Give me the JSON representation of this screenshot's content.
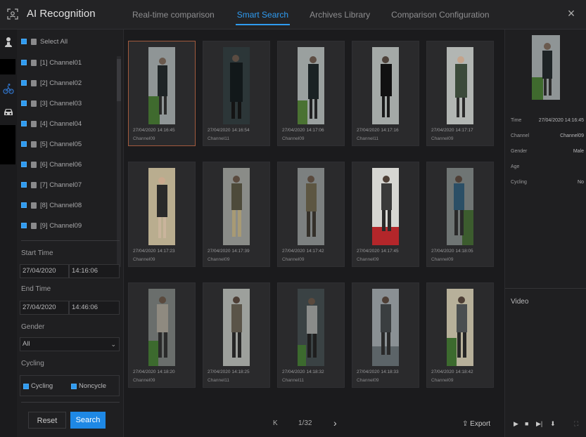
{
  "app": {
    "title": "AI Recognition",
    "icon": "face-scan-icon"
  },
  "tabs": [
    {
      "label": "Real-time comparison",
      "active": false
    },
    {
      "label": "Smart Search",
      "active": true
    },
    {
      "label": "Archives Library",
      "active": false
    },
    {
      "label": "Comparison Configuration",
      "active": false
    }
  ],
  "close": "×",
  "accent": "#2f9bf0",
  "filters": {
    "select_all": "Select All",
    "channels": [
      "[1] Channel01",
      "[2] Channel02",
      "[3] Channel03",
      "[4] Channel04",
      "[5] Channel05",
      "[6] Channel06",
      "[7] Channel07",
      "[8] Channel08",
      "[9] Channel09"
    ],
    "start_time_label": "Start Time",
    "start_date": "27/04/2020",
    "start_time": "14:16:06",
    "end_time_label": "End Time",
    "end_date": "27/04/2020",
    "end_time": "14:46:06",
    "gender_label": "Gender",
    "gender_value": "All",
    "cycling_label": "Cycling",
    "cycling_option": "Cycling",
    "noncycle_option": "Noncycle",
    "reset": "Reset",
    "search": "Search"
  },
  "results": [
    {
      "time": "27/04/2020 14:16:45",
      "channel": "Channel09"
    },
    {
      "time": "27/04/2020 14:16:54",
      "channel": "Channel11"
    },
    {
      "time": "27/04/2020 14:17:06",
      "channel": "Channel09"
    },
    {
      "time": "27/04/2020 14:17:16",
      "channel": "Channel11"
    },
    {
      "time": "27/04/2020 14:17:17",
      "channel": "Channel09"
    },
    {
      "time": "27/04/2020 14:17:23",
      "channel": "Channel09"
    },
    {
      "time": "27/04/2020 14:17:39",
      "channel": "Channel09"
    },
    {
      "time": "27/04/2020 14:17:42",
      "channel": "Channel09"
    },
    {
      "time": "27/04/2020 14:17:45",
      "channel": "Channel09"
    },
    {
      "time": "27/04/2020 14:18:05",
      "channel": "Channel09"
    },
    {
      "time": "27/04/2020 14:18:20",
      "channel": "Channel09"
    },
    {
      "time": "27/04/2020 14:18:25",
      "channel": "Channel11"
    },
    {
      "time": "27/04/2020 14:18:32",
      "channel": "Channel11"
    },
    {
      "time": "27/04/2020 14:18:33",
      "channel": "Channel09"
    },
    {
      "time": "27/04/2020 14:18:42",
      "channel": "Channel09"
    }
  ],
  "pager": {
    "page": "1/32",
    "first": "K",
    "last": "›"
  },
  "export": "Export",
  "detail": {
    "time_label": "Time",
    "time": "27/04/2020 14:16:45",
    "channel_label": "Channel",
    "channel": "Channel09",
    "gender_label": "Gender",
    "gender": "Male",
    "age_label": "Age",
    "age": "",
    "cycling_label": "Cycling",
    "cycling": "No",
    "video_label": "Video"
  }
}
